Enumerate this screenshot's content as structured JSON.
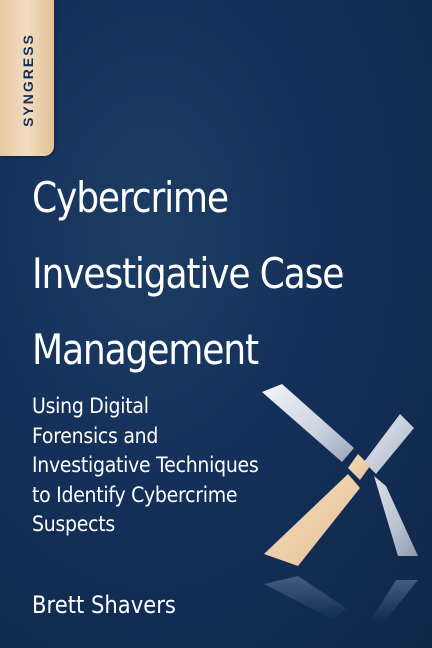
{
  "publisher": "SYNGRESS",
  "title_lines": [
    "Cybercrime",
    "Investigative Case",
    "Management"
  ],
  "subtitle_lines": [
    "Using Digital",
    "Forensics and",
    "Investigative Techniques",
    "to Identify Cybercrime",
    "Suspects"
  ],
  "author": "Brett Shavers",
  "colors": {
    "background": "#14305a",
    "tab": "#f0d6b6",
    "text": "#ffffff",
    "emblem_tan": "#f0d3ae",
    "emblem_light": "#c9cfdc"
  }
}
